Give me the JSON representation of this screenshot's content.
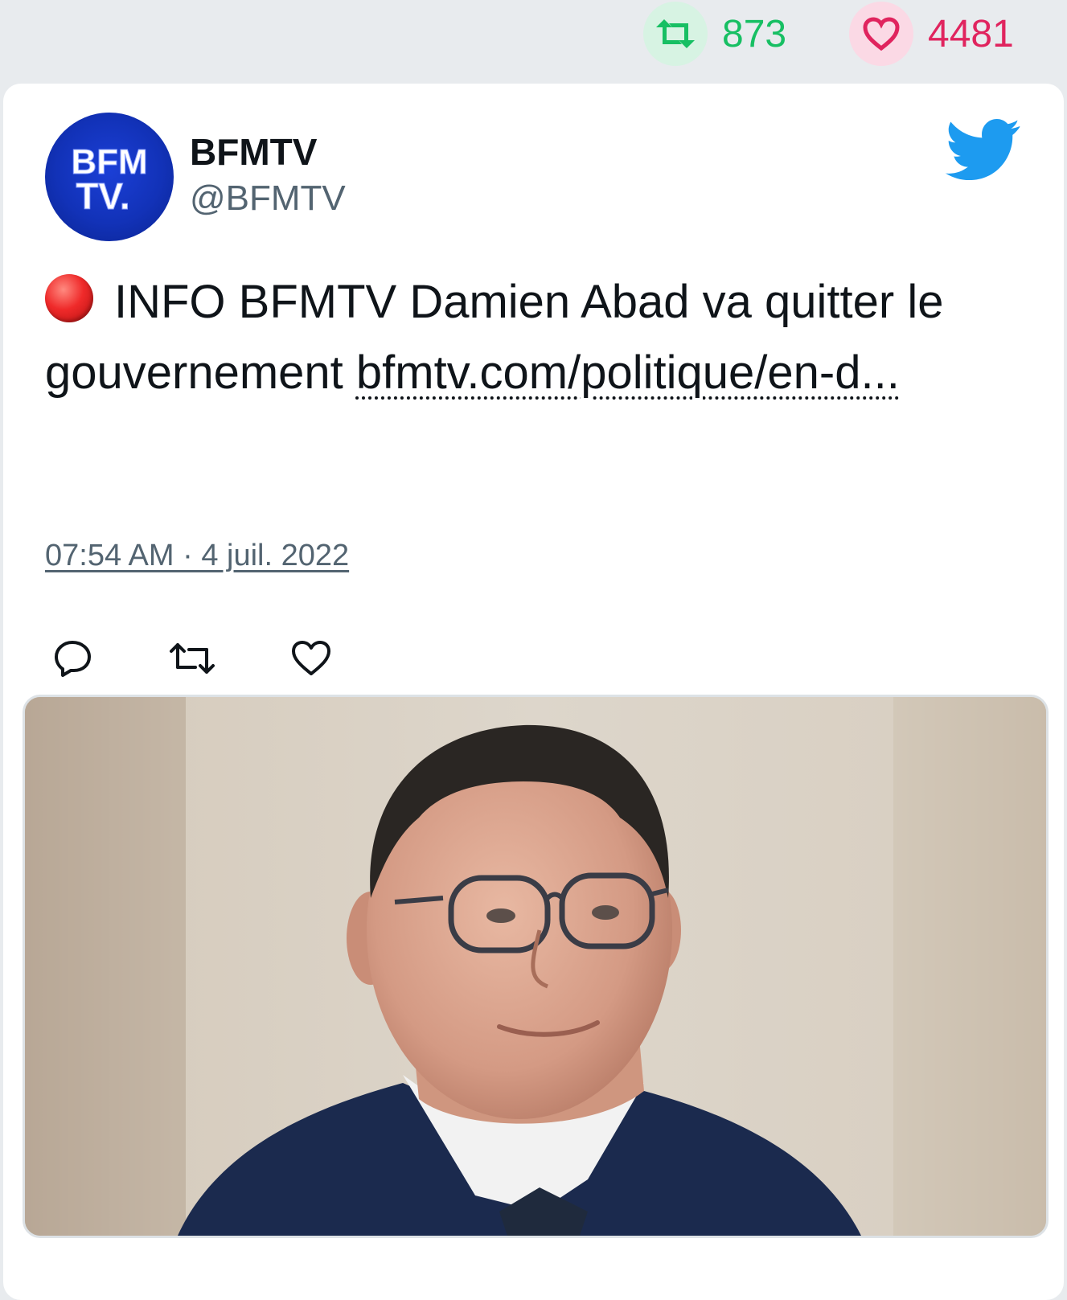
{
  "header_stats": {
    "retweets": "873",
    "likes": "4481"
  },
  "tweet": {
    "author_name": "BFMTV",
    "author_handle": "@BFMTV",
    "avatar_text_line1": "BFM",
    "avatar_text_line2": "TV.",
    "text_prefix": "INFO BFMTV Damien Abad va quitter le gouvernement ",
    "link_text": "bfmtv.com/politique/en-d...",
    "timestamp": "07:54 AM · 4 juil. 2022",
    "icons": {
      "retweet": "retweet-icon",
      "like": "heart-icon",
      "reply": "reply-icon",
      "platform": "twitter-bird-icon",
      "emoji": "red-circle-icon"
    }
  },
  "colors": {
    "retweet_green": "#17bf63",
    "like_red": "#e0245e",
    "twitter_blue": "#1d9bf0",
    "brand_blue": "#1232b8"
  }
}
